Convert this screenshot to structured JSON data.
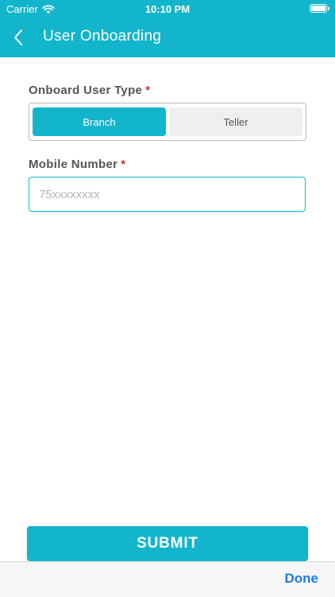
{
  "status_bar": {
    "carrier": "Carrier",
    "time": "10:10 PM"
  },
  "header": {
    "title": "User Onboarding",
    "back_icon": "chevron-left-icon",
    "background_color": "#12b5cb"
  },
  "form": {
    "user_type": {
      "label": "Onboard User Type",
      "required_mark": "*",
      "options": [
        "Branch",
        "Teller"
      ],
      "selected": "Branch"
    },
    "mobile": {
      "label": "Mobile Number",
      "required_mark": "*",
      "value": "",
      "placeholder": "75xxxxxxxx"
    }
  },
  "submit": {
    "label": "SUBMIT"
  },
  "keyboard_toolbar": {
    "done_label": "Done",
    "done_color": "#1f7ae0"
  }
}
